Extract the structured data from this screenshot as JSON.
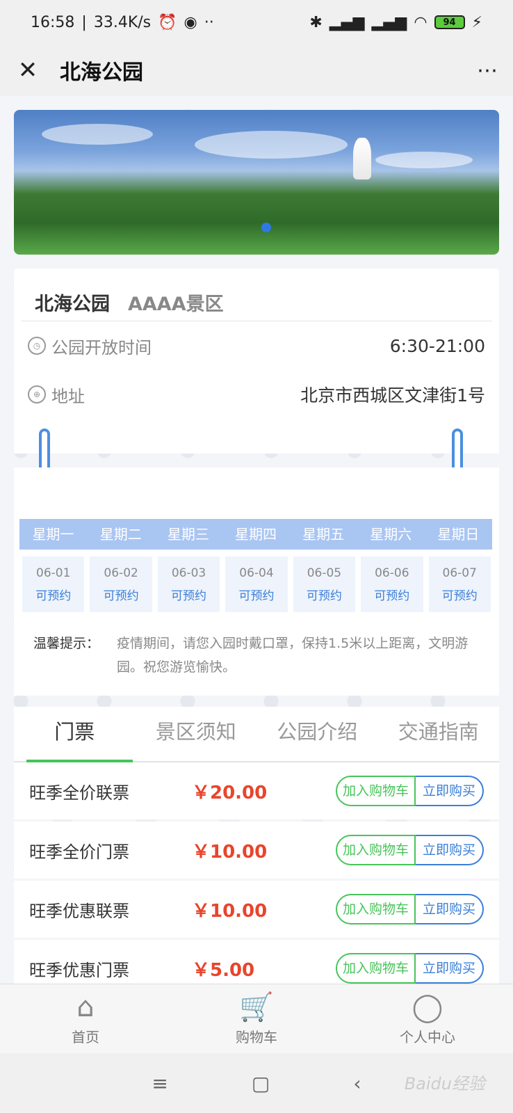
{
  "status_bar": {
    "time": "16:58",
    "speed": "33.4K/s",
    "battery": "94"
  },
  "header": {
    "title": "北海公园",
    "more": "⋯"
  },
  "banner": {
    "image_desc": "Beihai Park White Pagoda over lotus pond"
  },
  "park": {
    "name": "北海公园",
    "level": "AAAA景区",
    "hours_label": "公园开放时间",
    "hours_value": "6:30-21:00",
    "address_label": "地址",
    "address_value": "北京市西城区文津街1号"
  },
  "calendar": {
    "weekdays": [
      "星期一",
      "星期二",
      "星期三",
      "星期四",
      "星期五",
      "星期六",
      "星期日"
    ],
    "days": [
      {
        "date": "06-01",
        "status": "可预约"
      },
      {
        "date": "06-02",
        "status": "可预约"
      },
      {
        "date": "06-03",
        "status": "可预约"
      },
      {
        "date": "06-04",
        "status": "可预约"
      },
      {
        "date": "06-05",
        "status": "可预约"
      },
      {
        "date": "06-06",
        "status": "可预约"
      },
      {
        "date": "06-07",
        "status": "可预约"
      }
    ],
    "tip_label": "温馨提示：",
    "tip_text": "疫情期间，请您入园时戴口罩，保持1.5米以上距离，文明游园。祝您游览愉快。"
  },
  "tabs": [
    {
      "label": "门票",
      "active": true
    },
    {
      "label": "景区须知",
      "active": false
    },
    {
      "label": "公园介绍",
      "active": false
    },
    {
      "label": "交通指南",
      "active": false
    }
  ],
  "tickets": [
    {
      "name": "旺季全价联票",
      "price": "￥20.00"
    },
    {
      "name": "旺季全价门票",
      "price": "￥10.00"
    },
    {
      "name": "旺季优惠联票",
      "price": "￥10.00"
    },
    {
      "name": "旺季优惠门票",
      "price": "￥5.00"
    }
  ],
  "ticket_buttons": {
    "add_cart": "加入购物车",
    "buy_now": "立即购买"
  },
  "bottom_nav": [
    {
      "label": "首页",
      "icon": "home-icon"
    },
    {
      "label": "购物车",
      "icon": "cart-icon"
    },
    {
      "label": "个人中心",
      "icon": "user-icon"
    }
  ],
  "watermark": "Baidu经验"
}
